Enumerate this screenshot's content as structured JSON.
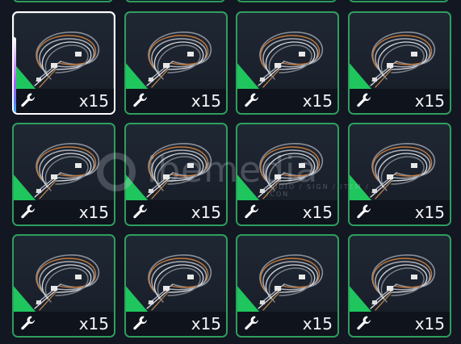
{
  "inventory": {
    "item_name_icon": "wire-bundle-icon",
    "category_icon": "wrench-icon",
    "accent_color": "#1fc65d",
    "border_color": "#2f9e5e",
    "selected_index": 0,
    "slots": [
      {
        "quantity": "x15"
      },
      {
        "quantity": "x15"
      },
      {
        "quantity": "x15"
      },
      {
        "quantity": "x15"
      },
      {
        "quantity": "x15"
      },
      {
        "quantity": "x15"
      },
      {
        "quantity": "x15"
      },
      {
        "quantity": "x15"
      },
      {
        "quantity": "x15"
      },
      {
        "quantity": "x15"
      },
      {
        "quantity": "x15"
      },
      {
        "quantity": "x15"
      }
    ]
  },
  "watermark": {
    "brand": "ibemedia",
    "tagline": "AUDIO / SIGN / ITEM / ICON"
  }
}
